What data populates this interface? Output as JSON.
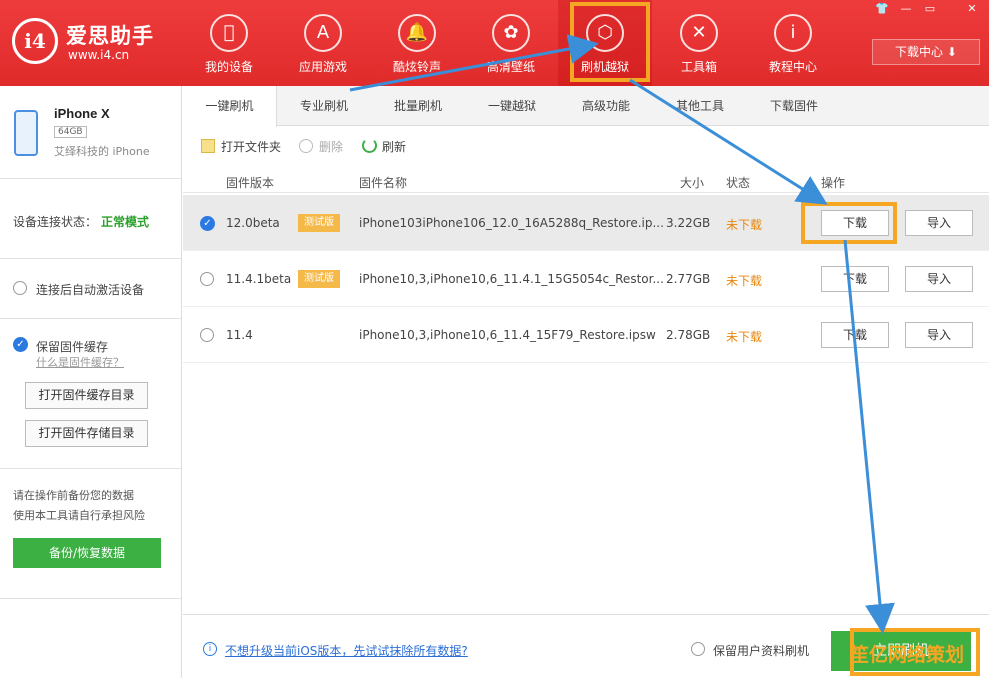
{
  "app": {
    "name": "爱思助手",
    "url": "www.i4.cn",
    "logo_mark": "i4"
  },
  "window_controls": [
    "👕",
    "—",
    "▭",
    "✕"
  ],
  "nav": [
    {
      "label": "我的设备",
      "icon": "apple-icon"
    },
    {
      "label": "应用游戏",
      "icon": "appstore-icon"
    },
    {
      "label": "酷炫铃声",
      "icon": "bell-icon"
    },
    {
      "label": "高清壁纸",
      "icon": "flower-icon"
    },
    {
      "label": "刷机越狱",
      "icon": "box-icon"
    },
    {
      "label": "工具箱",
      "icon": "tools-icon"
    },
    {
      "label": "教程中心",
      "icon": "info-icon"
    }
  ],
  "download_center": "下载中心",
  "device": {
    "name": "iPhone X",
    "capacity": "64GB",
    "owner": "艾绎科技的 iPhone"
  },
  "connection": {
    "label": "设备连接状态：",
    "value": "正常模式"
  },
  "sidebar": {
    "auto_activate": "连接后自动激活设备",
    "keep_cache": "保留固件缓存",
    "what_is_cache": "什么是固件缓存？",
    "open_cache_dir": "打开固件缓存目录",
    "open_store_dir": "打开固件存储目录",
    "warning_line1": "请在操作前备份您的数据",
    "warning_line2": "使用本工具请自行承担风险",
    "backup_button": "备份/恢复数据"
  },
  "tabs": [
    "一键刷机",
    "专业刷机",
    "批量刷机",
    "一键越狱",
    "高级功能",
    "其他工具",
    "下载固件"
  ],
  "toolbar": {
    "open_folder": "打开文件夹",
    "delete": "删除",
    "refresh": "刷新"
  },
  "table": {
    "headers": [
      "固件版本",
      "固件名称",
      "大小",
      "状态",
      "操作"
    ],
    "rows": [
      {
        "version": "12.0beta",
        "tag": "测试版",
        "name": "iPhone103iPhone106_12.0_16A5288q_Restore.ip...",
        "size": "3.22GB",
        "status": "未下载",
        "download": "下载",
        "import": "导入",
        "selected": true
      },
      {
        "version": "11.4.1beta",
        "tag": "测试版",
        "name": "iPhone10,3,iPhone10,6_11.4.1_15G5054c_Restor...",
        "size": "2.77GB",
        "status": "未下载",
        "download": "下载",
        "import": "导入",
        "selected": false
      },
      {
        "version": "11.4",
        "tag": "",
        "name": "iPhone10,3,iPhone10,6_11.4_15F79_Restore.ipsw",
        "size": "2.78GB",
        "status": "未下载",
        "download": "下载",
        "import": "导入",
        "selected": false
      }
    ]
  },
  "footer": {
    "link": "不想升级当前iOS版本，先试试抹除所有数据?",
    "keep_user_data": "保留用户资料刷机",
    "flash_button": "立即刷机"
  },
  "watermark": "笙亿网络策划",
  "colors": {
    "header_red": "#e02b2b",
    "highlight_orange": "#f5a623",
    "arrow_blue": "#3a8fd8",
    "green": "#3cb043",
    "status_orange": "#e8860c"
  }
}
